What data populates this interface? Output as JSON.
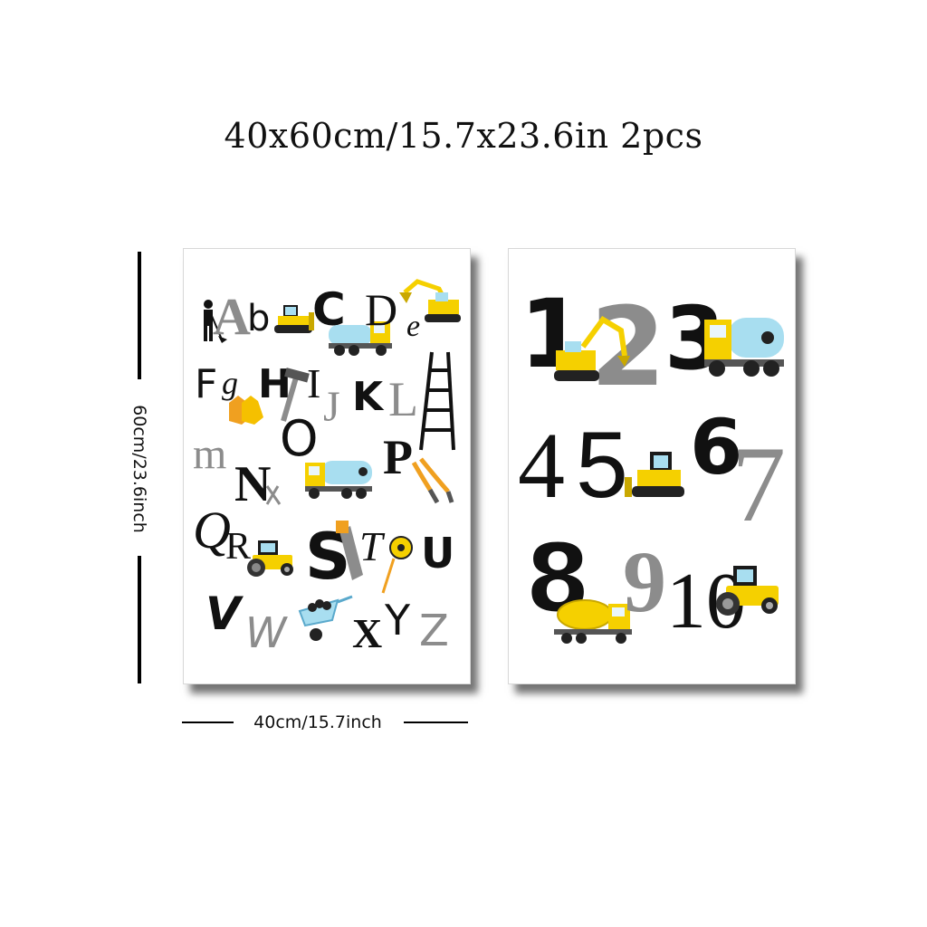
{
  "title": "40x60cm/15.7x23.6in 2pcs",
  "dimensions": {
    "height_label": "60cm/23.6inch",
    "width_label": "40cm/15.7inch"
  },
  "posters": {
    "alphabet": {
      "letters": [
        "A",
        "b",
        "C",
        "D",
        "e",
        "F",
        "g",
        "H",
        "I",
        "J",
        "K",
        "L",
        "m",
        "N",
        "O",
        "P",
        "Q",
        "R",
        "S",
        "T",
        "U",
        "V",
        "W",
        "X",
        "Y",
        "Z"
      ]
    },
    "numbers": {
      "digits": [
        "1",
        "2",
        "3",
        "4",
        "5",
        "6",
        "7",
        "8",
        "9",
        "10"
      ]
    }
  },
  "colors": {
    "vehicle_yellow": "#f5d000",
    "tank_blue": "#a8def0",
    "gray_letter": "#8c8c8c",
    "black_letter": "#111111",
    "orange_accent": "#f0a020"
  },
  "icons": [
    "worker-icon",
    "bulldozer-icon",
    "cement-mixer-icon",
    "excavator-icon",
    "ladder-icon",
    "gloves-icon",
    "hammer-icon",
    "saw-icon",
    "tape-measure-icon",
    "pliers-icon",
    "wheelbarrow-icon",
    "road-roller-icon",
    "water-truck-icon"
  ]
}
